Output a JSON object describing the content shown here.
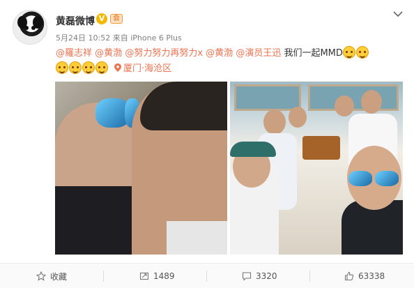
{
  "post": {
    "author": "黄磊微博",
    "verified_badge": "V",
    "rank_badge": "会",
    "date": "5月24日 10:52",
    "via_prefix": "来自",
    "device": "iPhone 6 Plus",
    "mentions": [
      "@羅志祥",
      "@黄渤",
      "@努力努力再努力x",
      "@黄渤",
      "@演员王迅"
    ],
    "text": "我们一起MMD",
    "emoji_count_line1": 2,
    "emoji_count_line2": 4,
    "location": "厦门·海沧区"
  },
  "actions": {
    "favorite": "收藏",
    "repost": "1489",
    "comment": "3320",
    "like": "63338"
  },
  "colors": {
    "mention": "#eb7350",
    "meta": "#808080",
    "badge": "#f5b800"
  }
}
